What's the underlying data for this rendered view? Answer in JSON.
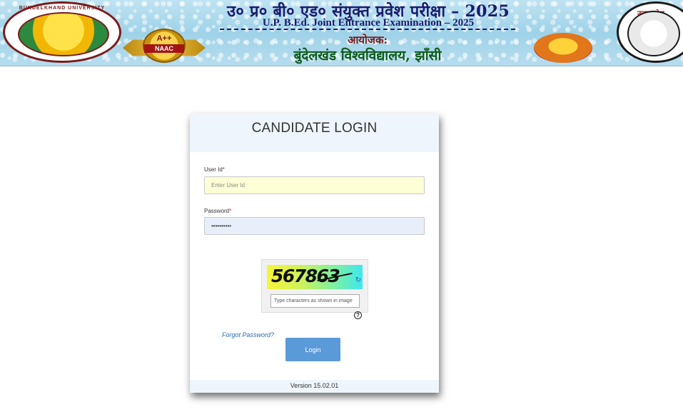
{
  "banner": {
    "title_hindi": "उ० प्र० बी० एड० संयुक्त प्रवेश परीक्षा – 2025",
    "title_english": "U.P. B.Ed. Joint Entrance Examination – 2025",
    "organizer_label": "आयोजक:",
    "university": "बुंदेलखंड विश्वविद्यालय, झाँसी",
    "left_logo_text": "BUNDELKHAND UNIVERSITY",
    "naac_grade": "A++",
    "naac_label": "NAAC",
    "right_logo_text": "उत्तर प्रदेश"
  },
  "login": {
    "title": "CANDIDATE LOGIN",
    "user_id_label": "User Id",
    "user_id_placeholder": "Enter User Id",
    "user_id_value": "",
    "password_label": "Password",
    "password_value": "••••••••••",
    "required_mark": "*",
    "captcha_text": "567863",
    "captcha_input_placeholder": "Type characters as shown in image",
    "forgot_password": "Forgot Password?",
    "login_button": "Login",
    "version": "Version 15.02.01"
  }
}
